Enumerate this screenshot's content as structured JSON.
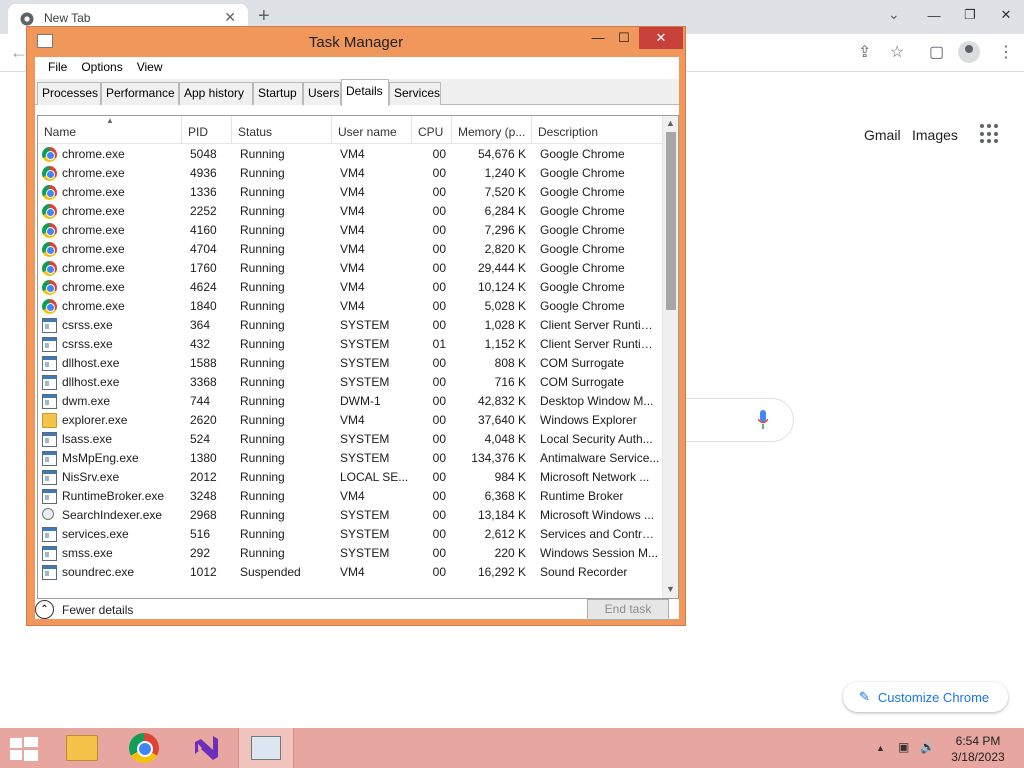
{
  "browser": {
    "tab_title": "New Tab",
    "tab_close": "✕",
    "new_tab": "+",
    "tabs_menu": "⌄",
    "win_minimize": "—",
    "win_restore": "❐",
    "win_close": "✕",
    "back": "←",
    "share_icon": "⇪",
    "star_icon": "☆",
    "sidepanel_icon": "▢",
    "menu_icon": "⋮",
    "gmail": "Gmail",
    "images": "Images",
    "customize_label": "Customize Chrome",
    "customize_icon": "✎"
  },
  "task_manager": {
    "title": "Task Manager",
    "minimize": "—",
    "maximize": "☐",
    "close": "✕",
    "menu": [
      "File",
      "Options",
      "View"
    ],
    "tabs": [
      "Processes",
      "Performance",
      "App history",
      "Startup",
      "Users",
      "Details",
      "Services"
    ],
    "active_tab": "Details",
    "columns": [
      "Name",
      "PID",
      "Status",
      "User name",
      "CPU",
      "Memory (p...",
      "Description"
    ],
    "sort_indicator": "▲",
    "rows": [
      {
        "icon": "chrome",
        "name": "chrome.exe",
        "pid": "5048",
        "status": "Running",
        "user": "VM4",
        "cpu": "00",
        "mem": "54,676 K",
        "desc": "Google Chrome"
      },
      {
        "icon": "chrome",
        "name": "chrome.exe",
        "pid": "4936",
        "status": "Running",
        "user": "VM4",
        "cpu": "00",
        "mem": "1,240 K",
        "desc": "Google Chrome"
      },
      {
        "icon": "chrome",
        "name": "chrome.exe",
        "pid": "1336",
        "status": "Running",
        "user": "VM4",
        "cpu": "00",
        "mem": "7,520 K",
        "desc": "Google Chrome"
      },
      {
        "icon": "chrome",
        "name": "chrome.exe",
        "pid": "2252",
        "status": "Running",
        "user": "VM4",
        "cpu": "00",
        "mem": "6,284 K",
        "desc": "Google Chrome"
      },
      {
        "icon": "chrome",
        "name": "chrome.exe",
        "pid": "4160",
        "status": "Running",
        "user": "VM4",
        "cpu": "00",
        "mem": "7,296 K",
        "desc": "Google Chrome"
      },
      {
        "icon": "chrome",
        "name": "chrome.exe",
        "pid": "4704",
        "status": "Running",
        "user": "VM4",
        "cpu": "00",
        "mem": "2,820 K",
        "desc": "Google Chrome"
      },
      {
        "icon": "chrome",
        "name": "chrome.exe",
        "pid": "1760",
        "status": "Running",
        "user": "VM4",
        "cpu": "00",
        "mem": "29,444 K",
        "desc": "Google Chrome"
      },
      {
        "icon": "chrome",
        "name": "chrome.exe",
        "pid": "4624",
        "status": "Running",
        "user": "VM4",
        "cpu": "00",
        "mem": "10,124 K",
        "desc": "Google Chrome"
      },
      {
        "icon": "chrome",
        "name": "chrome.exe",
        "pid": "1840",
        "status": "Running",
        "user": "VM4",
        "cpu": "00",
        "mem": "5,028 K",
        "desc": "Google Chrome"
      },
      {
        "icon": "window",
        "name": "csrss.exe",
        "pid": "364",
        "status": "Running",
        "user": "SYSTEM",
        "cpu": "00",
        "mem": "1,028 K",
        "desc": "Client Server Runtim..."
      },
      {
        "icon": "window",
        "name": "csrss.exe",
        "pid": "432",
        "status": "Running",
        "user": "SYSTEM",
        "cpu": "01",
        "mem": "1,152 K",
        "desc": "Client Server Runtim..."
      },
      {
        "icon": "window",
        "name": "dllhost.exe",
        "pid": "1588",
        "status": "Running",
        "user": "SYSTEM",
        "cpu": "00",
        "mem": "808 K",
        "desc": "COM Surrogate"
      },
      {
        "icon": "window",
        "name": "dllhost.exe",
        "pid": "3368",
        "status": "Running",
        "user": "SYSTEM",
        "cpu": "00",
        "mem": "716 K",
        "desc": "COM Surrogate"
      },
      {
        "icon": "window",
        "name": "dwm.exe",
        "pid": "744",
        "status": "Running",
        "user": "DWM-1",
        "cpu": "00",
        "mem": "42,832 K",
        "desc": "Desktop Window M..."
      },
      {
        "icon": "folder",
        "name": "explorer.exe",
        "pid": "2620",
        "status": "Running",
        "user": "VM4",
        "cpu": "00",
        "mem": "37,640 K",
        "desc": "Windows Explorer"
      },
      {
        "icon": "window",
        "name": "lsass.exe",
        "pid": "524",
        "status": "Running",
        "user": "SYSTEM",
        "cpu": "00",
        "mem": "4,048 K",
        "desc": "Local Security Auth..."
      },
      {
        "icon": "window",
        "name": "MsMpEng.exe",
        "pid": "1380",
        "status": "Running",
        "user": "SYSTEM",
        "cpu": "00",
        "mem": "134,376 K",
        "desc": "Antimalware Service..."
      },
      {
        "icon": "window",
        "name": "NisSrv.exe",
        "pid": "2012",
        "status": "Running",
        "user": "LOCAL SE...",
        "cpu": "00",
        "mem": "984 K",
        "desc": "Microsoft Network ..."
      },
      {
        "icon": "window",
        "name": "RuntimeBroker.exe",
        "pid": "3248",
        "status": "Running",
        "user": "VM4",
        "cpu": "00",
        "mem": "6,368 K",
        "desc": "Runtime Broker"
      },
      {
        "icon": "search",
        "name": "SearchIndexer.exe",
        "pid": "2968",
        "status": "Running",
        "user": "SYSTEM",
        "cpu": "00",
        "mem": "13,184 K",
        "desc": "Microsoft Windows ..."
      },
      {
        "icon": "window",
        "name": "services.exe",
        "pid": "516",
        "status": "Running",
        "user": "SYSTEM",
        "cpu": "00",
        "mem": "2,612 K",
        "desc": "Services and Control..."
      },
      {
        "icon": "window",
        "name": "smss.exe",
        "pid": "292",
        "status": "Running",
        "user": "SYSTEM",
        "cpu": "00",
        "mem": "220 K",
        "desc": "Windows Session M..."
      },
      {
        "icon": "window",
        "name": "soundrec.exe",
        "pid": "1012",
        "status": "Suspended",
        "user": "VM4",
        "cpu": "00",
        "mem": "16,292 K",
        "desc": "Sound Recorder"
      }
    ],
    "scroll_up": "▲",
    "scroll_down": "▼",
    "fewer_details": "Fewer details",
    "fewer_icon": "⌃",
    "end_task": "End task"
  },
  "taskbar": {
    "tray_arrow": "▲",
    "tray_network": "▣",
    "tray_volume": "🔊",
    "time": "6:54 PM",
    "date": "3/18/2023"
  },
  "colors": {
    "window_frame": "#f0975c",
    "close_button": "#c7403a",
    "taskbar": "#e8a6a0",
    "accent_blue": "#1a73e8"
  }
}
